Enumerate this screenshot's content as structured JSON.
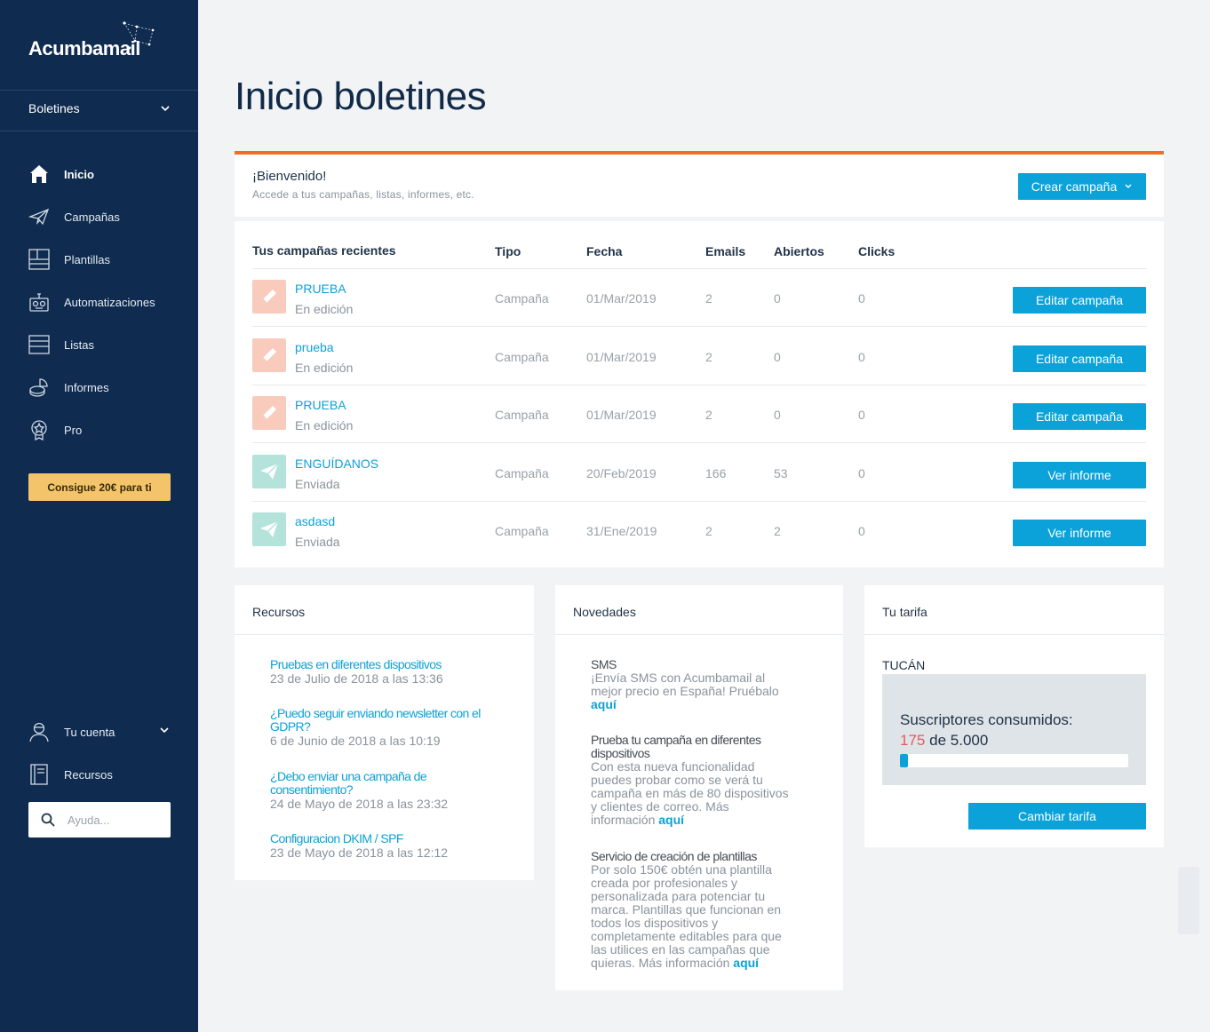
{
  "brand": {
    "name": "Acumbamail"
  },
  "sidebar": {
    "section": "Boletines",
    "items": [
      {
        "label": "Inicio",
        "icon": "home-icon",
        "active": true
      },
      {
        "label": "Campañas",
        "icon": "paper-plane-icon"
      },
      {
        "label": "Plantillas",
        "icon": "template-icon"
      },
      {
        "label": "Automatizaciones",
        "icon": "robot-icon"
      },
      {
        "label": "Listas",
        "icon": "list-icon"
      },
      {
        "label": "Informes",
        "icon": "chart-icon"
      },
      {
        "label": "Pro",
        "icon": "badge-icon"
      }
    ],
    "promo": "Consigue 20€ para ti",
    "account": "Tu cuenta",
    "resources": "Recursos",
    "help_placeholder": "Ayuda..."
  },
  "page": {
    "title": "Inicio boletines"
  },
  "welcome": {
    "title": "¡Bienvenido!",
    "subtitle": "Accede a tus campañas, listas, informes, etc.",
    "create_button": "Crear campaña"
  },
  "campaigns": {
    "headers": {
      "name": "Tus campañas recientes",
      "type": "Tipo",
      "date": "Fecha",
      "emails": "Emails",
      "opens": "Abiertos",
      "clicks": "Clicks"
    },
    "rows": [
      {
        "name": "PRUEBA",
        "status": "En edición",
        "kind": "edit",
        "type": "Campaña",
        "date": "01/Mar/2019",
        "emails": "2",
        "opens": "0",
        "clicks": "0",
        "action": "Editar campaña"
      },
      {
        "name": "prueba",
        "status": "En edición",
        "kind": "edit",
        "type": "Campaña",
        "date": "01/Mar/2019",
        "emails": "2",
        "opens": "0",
        "clicks": "0",
        "action": "Editar campaña"
      },
      {
        "name": "PRUEBA",
        "status": "En edición",
        "kind": "edit",
        "type": "Campaña",
        "date": "01/Mar/2019",
        "emails": "2",
        "opens": "0",
        "clicks": "0",
        "action": "Editar campaña"
      },
      {
        "name": "ENGUÍDANOS",
        "status": "Enviada",
        "kind": "sent",
        "type": "Campaña",
        "date": "20/Feb/2019",
        "emails": "166",
        "opens": "53",
        "clicks": "0",
        "action": "Ver informe"
      },
      {
        "name": "asdasd",
        "status": "Enviada",
        "kind": "sent",
        "type": "Campaña",
        "date": "31/Ene/2019",
        "emails": "2",
        "opens": "2",
        "clicks": "0",
        "action": "Ver informe"
      }
    ]
  },
  "resources": {
    "title": "Recursos",
    "items": [
      {
        "link": "Pruebas en diferentes dispositivos",
        "date": "23 de Julio de 2018 a las 13:36"
      },
      {
        "link": "¿Puedo seguir enviando newsletter con el GDPR?",
        "date": "6 de Junio de 2018 a las 10:19"
      },
      {
        "link": "¿Debo enviar una campaña de consentimiento?",
        "date": "24 de Mayo de 2018 a las 23:32"
      },
      {
        "link": "Configuracion DKIM / SPF",
        "date": "23 de Mayo de 2018 a las 12:12"
      }
    ]
  },
  "news": {
    "title": "Novedades",
    "items": [
      {
        "title": "SMS",
        "body": "¡Envía SMS con Acumbamail al mejor precio en España! Pruébalo",
        "link": "aquí"
      },
      {
        "title": "Prueba tu campaña en diferentes dispositivos",
        "body": "Con esta nueva funcionalidad puedes probar como se verá tu campaña en más de 80 dispositivos y clientes de correo. Más información",
        "link": "aquí"
      },
      {
        "title": "Servicio de creación de plantillas",
        "body": "Por solo 150€ obtén una plantilla creada por profesionales y personalizada para potenciar tu marca. Plantillas que funcionan en todos los dispositivos y completamente editables para que las utilices en las campañas que quieras. Más información",
        "link": "aquí"
      }
    ]
  },
  "plan": {
    "title": "Tu tarifa",
    "name": "TUCÁN",
    "label": "Suscriptores consumidos:",
    "used": "175",
    "of": "de",
    "total": "5.000",
    "usage_fraction": 0.035,
    "button": "Cambiar tarifa"
  },
  "colors": {
    "sidebar": "#0f2b4f",
    "accent": "#0aa2d8",
    "orange": "#ee6f1d",
    "promo": "#f3c46a"
  }
}
